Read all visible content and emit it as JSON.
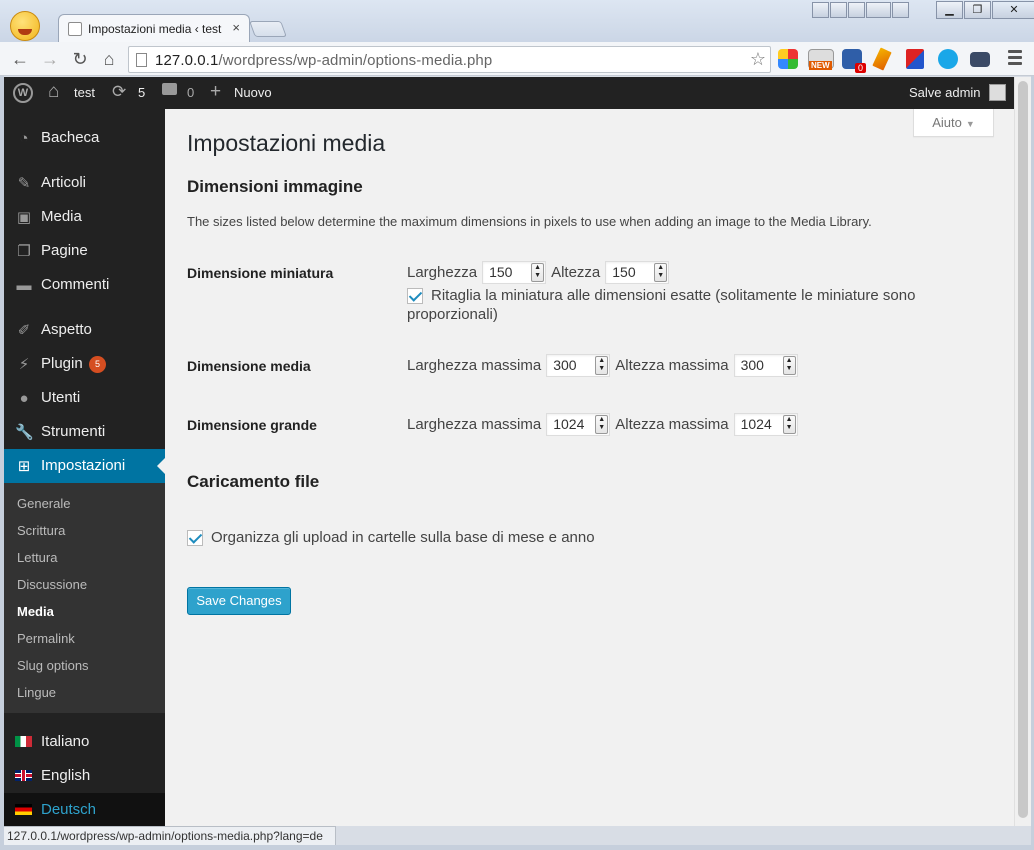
{
  "browser": {
    "tab_title": "Impostazioni media ‹ test",
    "tab_close": "×",
    "url_host": "127.0.0.1",
    "url_path": "/wordpress/wp-admin/options-media.php",
    "status_url": "127.0.0.1/wordpress/wp-admin/options-media.php?lang=de",
    "ext_new_label": "NEW",
    "ext_badge": "0"
  },
  "adminbar": {
    "site_name": "test",
    "updates_count": "5",
    "comments_count": "0",
    "new_label": "Nuovo",
    "greeting": "Salve admin"
  },
  "sidebar": {
    "items": [
      {
        "label": "Bacheca"
      },
      {
        "label": "Articoli"
      },
      {
        "label": "Media"
      },
      {
        "label": "Pagine"
      },
      {
        "label": "Commenti"
      },
      {
        "label": "Aspetto"
      },
      {
        "label": "Plugin",
        "badge": "5"
      },
      {
        "label": "Utenti"
      },
      {
        "label": "Strumenti"
      },
      {
        "label": "Impostazioni"
      }
    ],
    "submenu": [
      "Generale",
      "Scrittura",
      "Lettura",
      "Discussione",
      "Media",
      "Permalink",
      "Slug options",
      "Lingue"
    ],
    "languages": [
      "Italiano",
      "English",
      "Deutsch"
    ]
  },
  "main": {
    "help_label": "Aiuto",
    "title": "Impostazioni media",
    "sizes_heading": "Dimensioni immagine",
    "sizes_desc": "The sizes listed below determine the maximum dimensions in pixels to use when adding an image to the Media Library.",
    "thumb": {
      "label": "Dimensione miniatura",
      "width_label": "Larghezza",
      "width": "150",
      "height_label": "Altezza",
      "height": "150",
      "crop_label_line1": "Ritaglia la miniatura alle dimensioni esatte (solitamente le miniature sono",
      "crop_label_line2": "proporzionali)"
    },
    "medium": {
      "label": "Dimensione media",
      "width_label": "Larghezza massima",
      "width": "300",
      "height_label": "Altezza massima",
      "height": "300"
    },
    "large": {
      "label": "Dimensione grande",
      "width_label": "Larghezza massima",
      "width": "1024",
      "height_label": "Altezza massima",
      "height": "1024"
    },
    "upload_heading": "Caricamento file",
    "organize_label": "Organizza gli upload in cartelle sulla base di mese e anno",
    "save_label": "Save Changes"
  },
  "colors": {
    "admin_bg": "#222222",
    "active_blue": "#0074a2",
    "button_blue": "#2ea2cc",
    "badge_orange": "#d54e21"
  }
}
